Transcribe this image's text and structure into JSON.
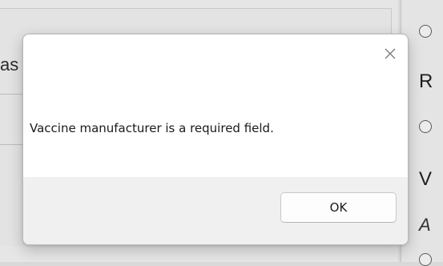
{
  "background": {
    "left_fragment": "as",
    "right_labels": [
      "R",
      "V",
      "A"
    ]
  },
  "dialog": {
    "message": "Vaccine manufacturer is a required field.",
    "ok_label": "OK",
    "close_icon": "close-icon"
  },
  "colors": {
    "dialog_bg": "#ffffff",
    "footer_bg": "#f0f0f0",
    "overlay_bg": "#d9d9d9"
  }
}
